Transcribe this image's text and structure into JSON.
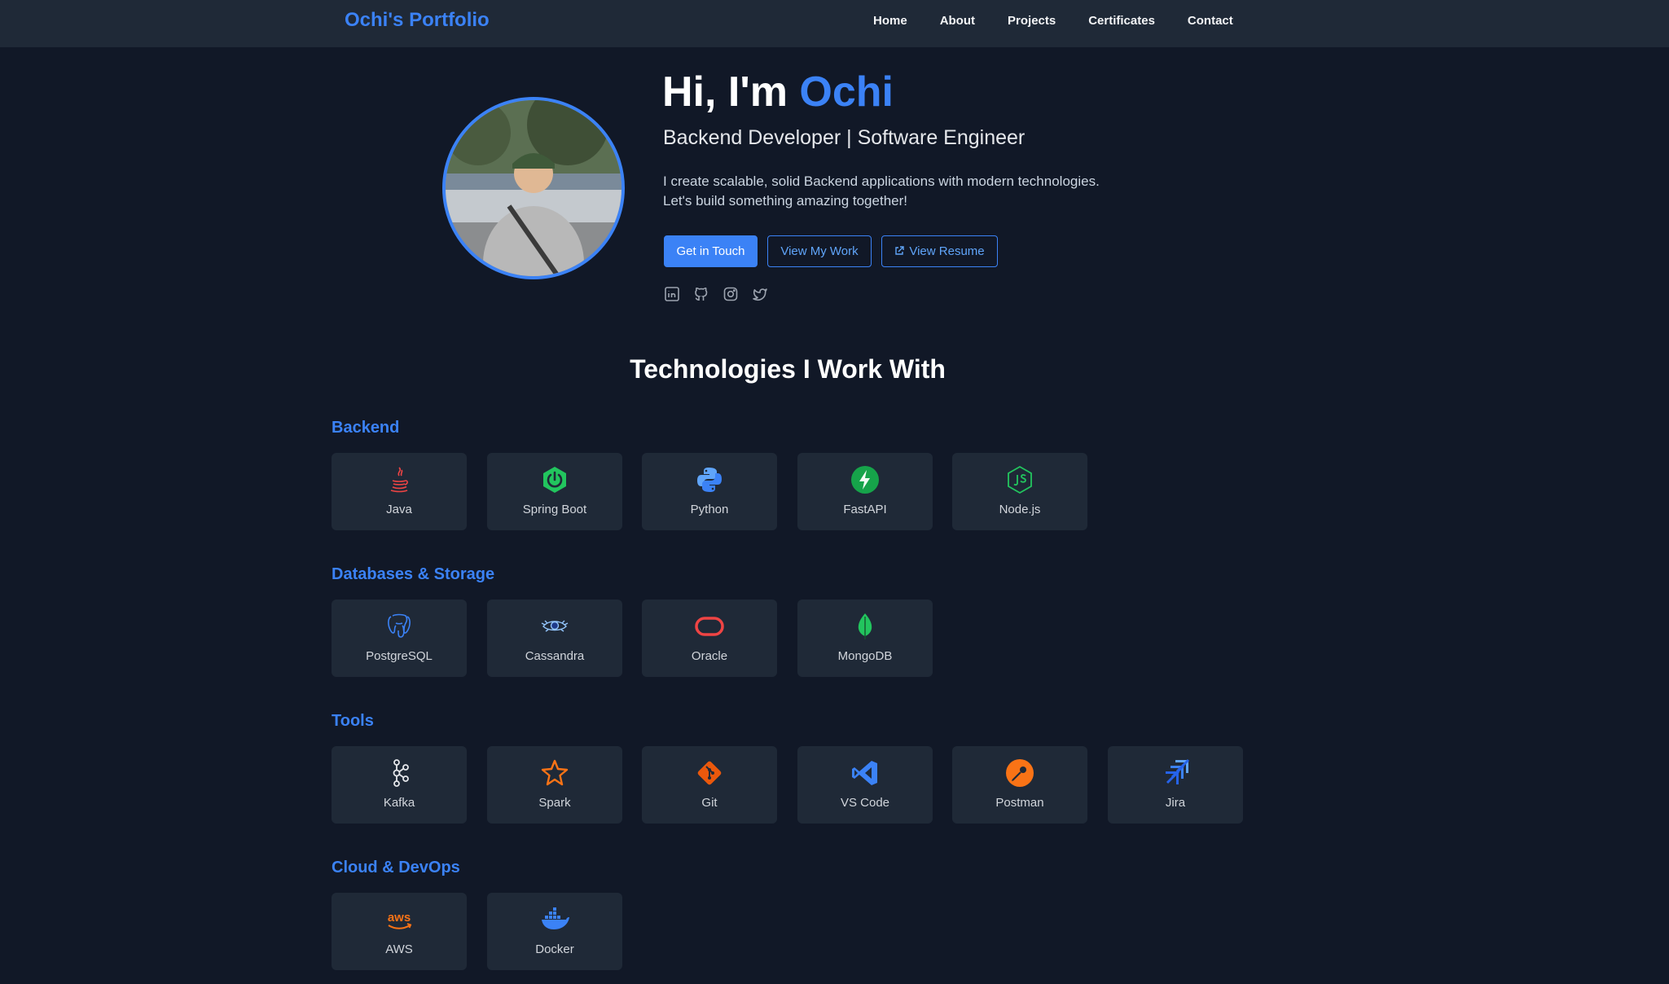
{
  "nav": {
    "brand": "Ochi's Portfolio",
    "links": [
      "Home",
      "About",
      "Projects",
      "Certificates",
      "Contact"
    ]
  },
  "hero": {
    "greeting": "Hi, I'm ",
    "name": "Ochi",
    "subtitle": "Backend Developer | Software Engineer",
    "description_line1": "I create scalable, solid Backend applications with modern technologies.",
    "description_line2": "Let's build something amazing together!",
    "buttons": {
      "contact": "Get in Touch",
      "work": "View My Work",
      "resume": "View Resume"
    },
    "socials": [
      "linkedin-icon",
      "github-icon",
      "instagram-icon",
      "twitter-icon"
    ]
  },
  "technologies": {
    "title": "Technologies I Work With",
    "categories": [
      {
        "title": "Backend",
        "items": [
          "Java",
          "Spring Boot",
          "Python",
          "FastAPI",
          "Node.js"
        ]
      },
      {
        "title": "Databases & Storage",
        "items": [
          "PostgreSQL",
          "Cassandra",
          "Oracle",
          "MongoDB"
        ]
      },
      {
        "title": "Tools",
        "items": [
          "Kafka",
          "Spark",
          "Git",
          "VS Code",
          "Postman",
          "Jira"
        ]
      },
      {
        "title": "Cloud & DevOps",
        "items": [
          "AWS",
          "Docker"
        ]
      }
    ]
  },
  "colors": {
    "background": "#111827",
    "nav": "#1f2937",
    "accent": "#3b82f6",
    "card": "#1f2937"
  }
}
